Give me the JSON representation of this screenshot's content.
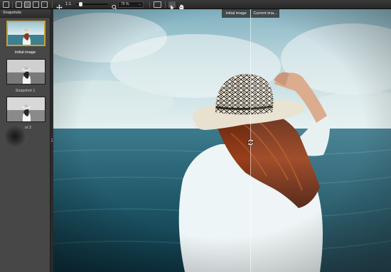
{
  "toolbar": {
    "zoom_ratio": "1:1",
    "zoom_percent": "75 %"
  },
  "sidebar": {
    "title": "Snapshots",
    "snapshots": [
      {
        "label": "Initial image",
        "selected": true
      },
      {
        "label": "Snapshot 1",
        "selected": false
      },
      {
        "label": "ot 2",
        "selected": false
      }
    ]
  },
  "compare": {
    "left_label": "Initial image",
    "right_label": "Current ima..."
  },
  "colors": {
    "selection_border": "#c9a232",
    "panel_bg": "#474747",
    "toolbar_bg": "#2e2e2e"
  }
}
